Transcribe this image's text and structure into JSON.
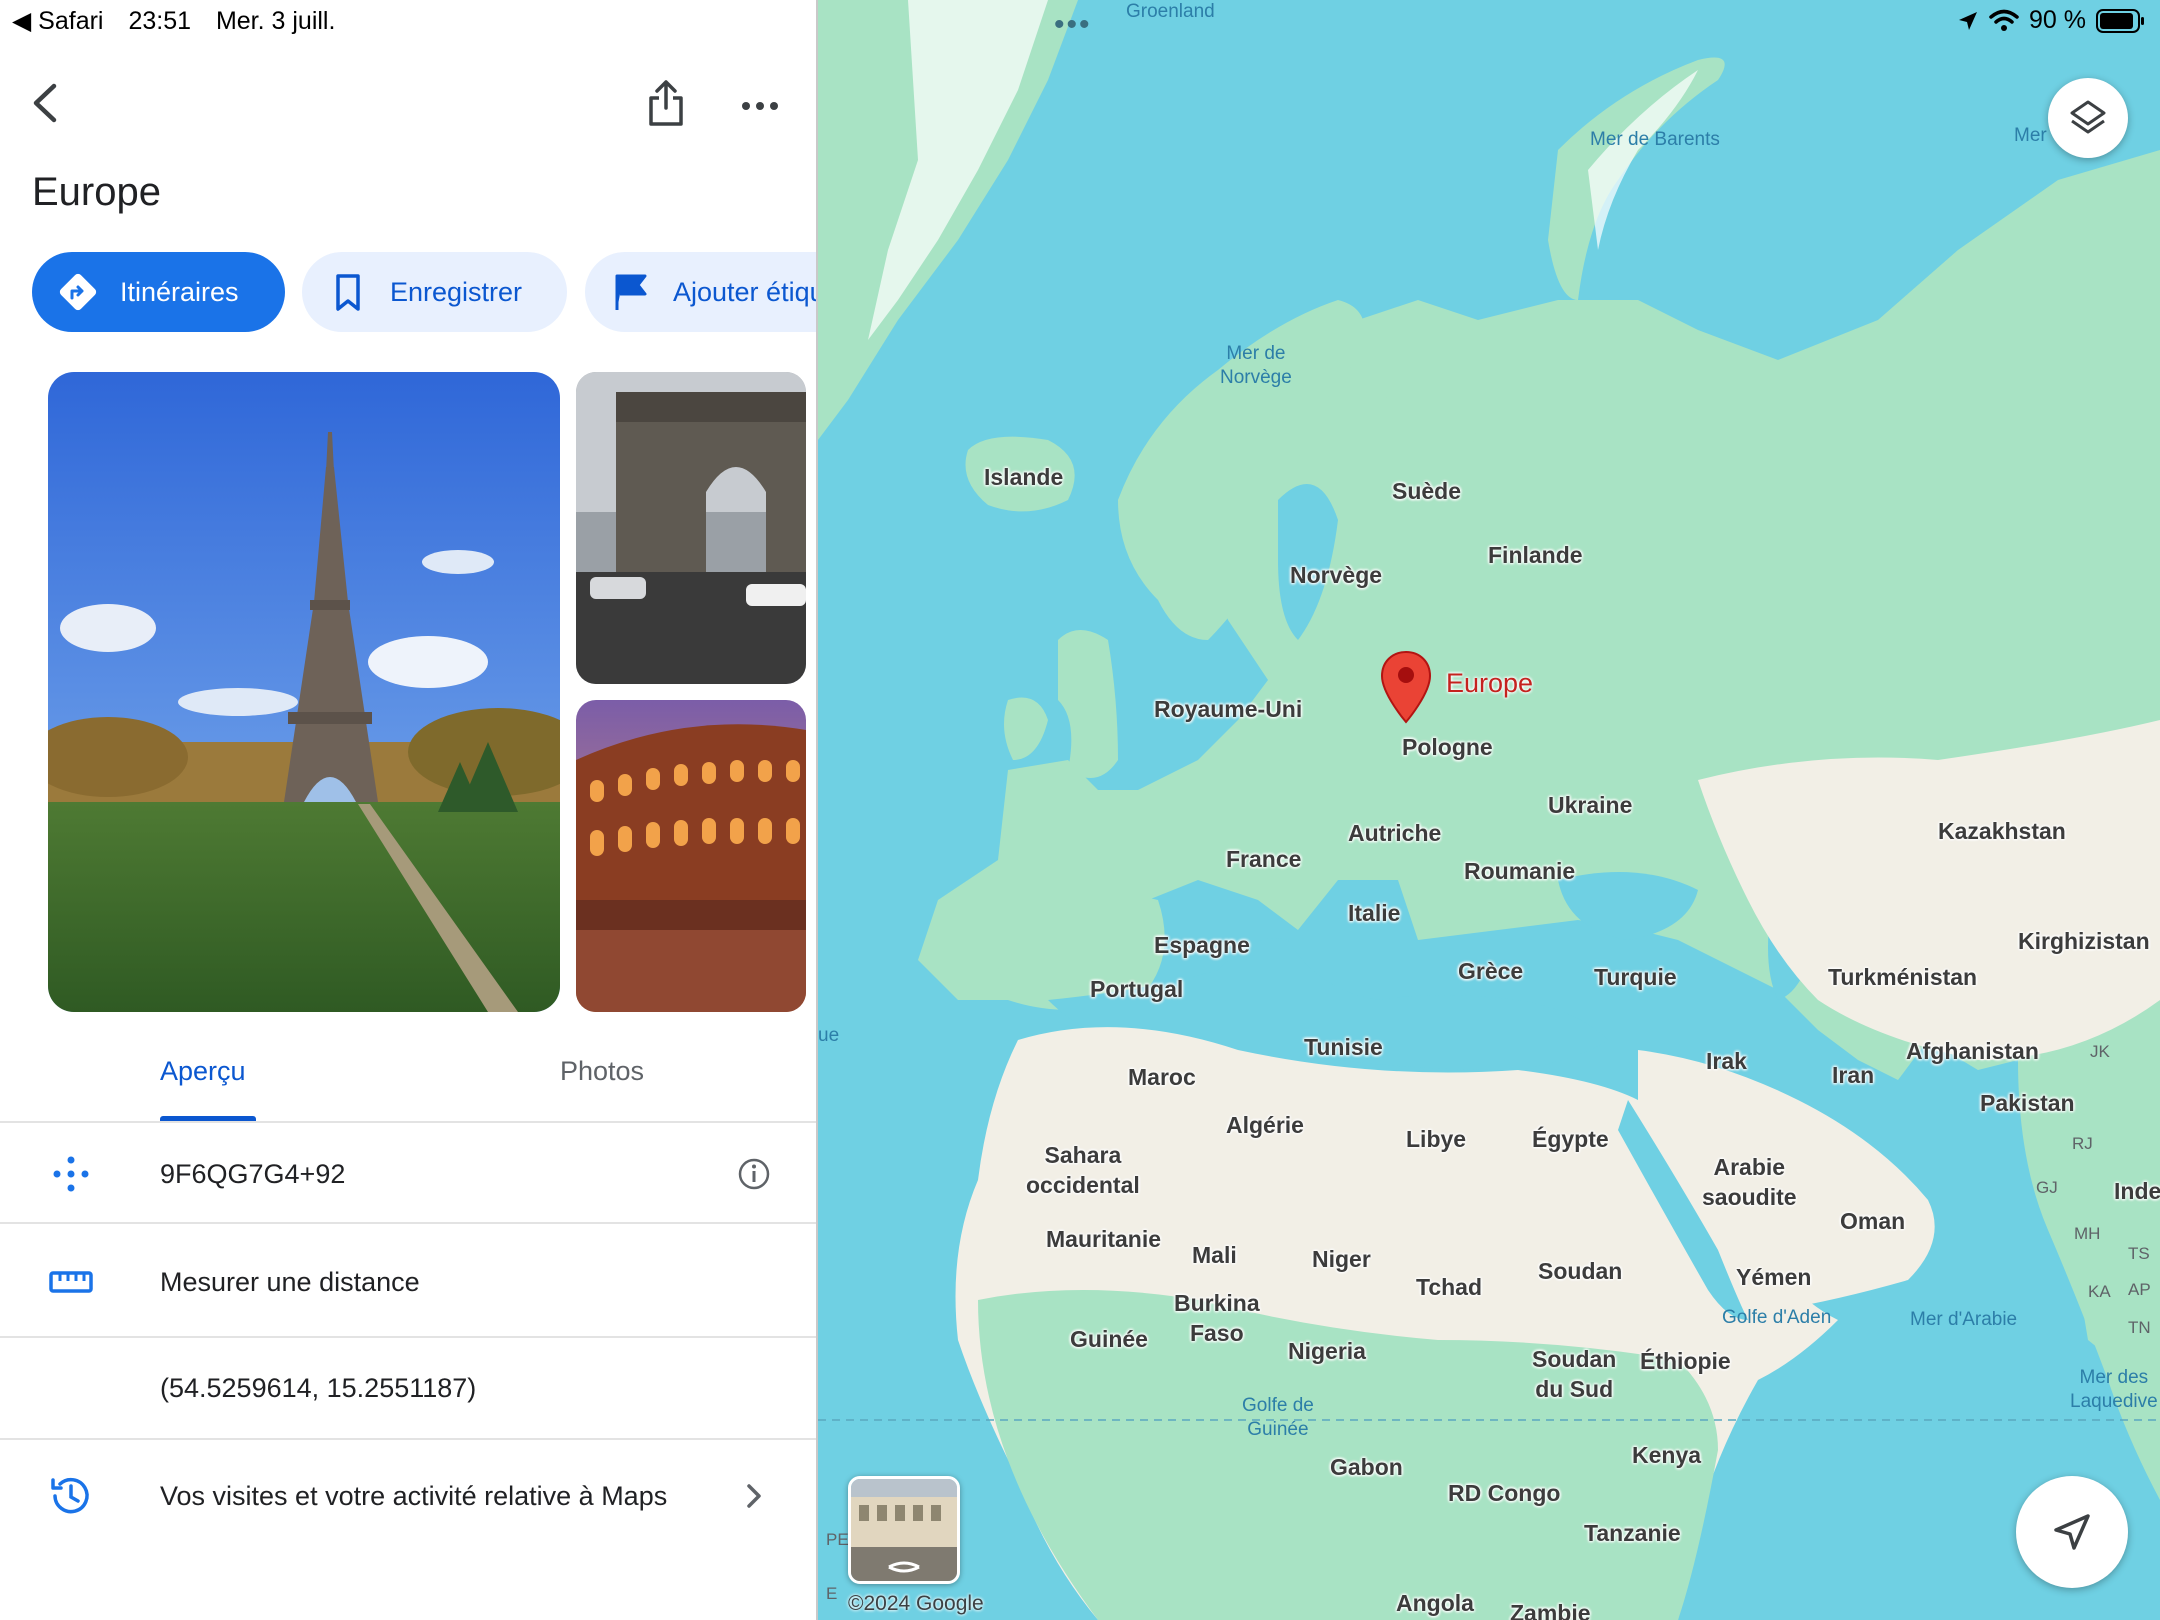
{
  "status_bar": {
    "back_app": "◀ Safari",
    "time": "23:51",
    "date": "Mer. 3 juill.",
    "battery": "90 %"
  },
  "place": {
    "title": "Europe"
  },
  "actions": {
    "directions": "Itinéraires",
    "save": "Enregistrer",
    "label": "Ajouter étiquette"
  },
  "tabs": {
    "overview": "Aperçu",
    "photos": "Photos"
  },
  "details": {
    "plus_code": "9F6QG7G4+92",
    "measure": "Mesurer une distance",
    "coordinates": "(54.5259614, 15.2551187)",
    "activity": "Vos visites et votre activité relative à Maps"
  },
  "map": {
    "pin_label": "Europe",
    "copyright": "©2024 Google",
    "countries": {
      "islande": "Islande",
      "suede": "Suède",
      "finlande": "Finlande",
      "norvege": "Norvège",
      "royaume_uni": "Royaume-Uni",
      "pologne": "Pologne",
      "ukraine": "Ukraine",
      "kazakhstan": "Kazakhstan",
      "france": "France",
      "autriche": "Autriche",
      "roumanie": "Roumanie",
      "italie": "Italie",
      "espagne": "Espagne",
      "portugal": "Portugal",
      "grece": "Grèce",
      "turquie": "Turquie",
      "kirghizistan": "Kirghizistan",
      "turkmenistan": "Turkménistan",
      "tunisie": "Tunisie",
      "maroc": "Maroc",
      "irak": "Irak",
      "iran": "Iran",
      "afghanistan": "Afghanistan",
      "pakistan": "Pakistan",
      "algerie": "Algérie",
      "libye": "Libye",
      "egypte": "Égypte",
      "sahara": "Sahara\noccidental",
      "arabie": "Arabie\nsaoudite",
      "oman": "Oman",
      "inde": "Inde",
      "mauritanie": "Mauritanie",
      "mali": "Mali",
      "niger": "Niger",
      "tchad": "Tchad",
      "soudan": "Soudan",
      "yemen": "Yémen",
      "burkina": "Burkina\nFaso",
      "guinee": "Guinée",
      "nigeria": "Nigeria",
      "soudan_sud": "Soudan\ndu Sud",
      "ethiopie": "Éthiopie",
      "kenya": "Kenya",
      "gabon": "Gabon",
      "rdc": "RD Congo",
      "tanzanie": "Tanzanie",
      "angola": "Angola",
      "zambie": "Zambie"
    },
    "waters": {
      "groenland": "Groenland",
      "barents": "Mer de Barents",
      "mer_cut": "Mer",
      "norvege_sea": "Mer de\nNorvège",
      "aden": "Golfe d'Aden",
      "arabie_sea": "Mer d'Arabie",
      "guinee_gulf": "Golfe de\nGuinée",
      "laquedive": "Mer des\nLaquedive",
      "ue": "ue"
    },
    "small": {
      "jk": "JK",
      "rj": "RJ",
      "gj": "GJ",
      "mh": "MH",
      "ts": "TS",
      "ka": "KA",
      "ap": "AP",
      "tn": "TN",
      "pe": "PE",
      "e": "E"
    }
  },
  "colors": {
    "accent": "#1a73e8",
    "chip_bg": "#e8f0fe",
    "water": "#6fd0e3",
    "land_green": "#a8e3c4",
    "desert": "#f2efe6",
    "pin": "#ea4335"
  }
}
